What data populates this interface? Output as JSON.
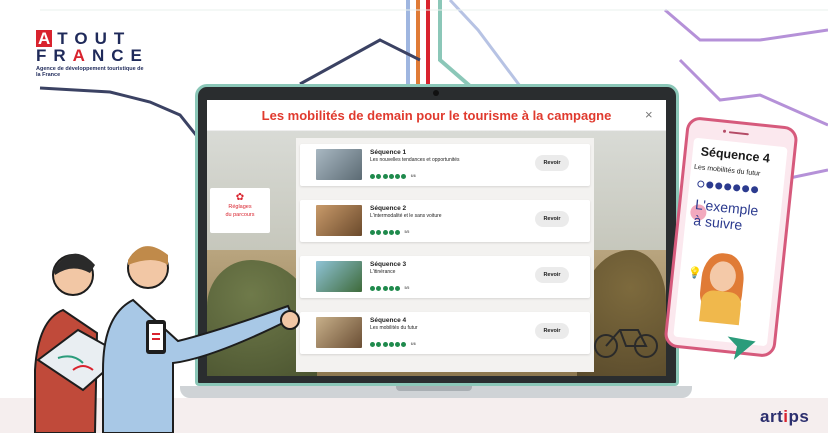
{
  "logo": {
    "line1_first": "A",
    "line1_rest": "TOUT",
    "line2_a": "FR",
    "line2_b": "A",
    "line2_c": "NCE",
    "tagline": "Agence de développement touristique de la France"
  },
  "modal": {
    "title": "Les mobilités de demain pour le tourisme à la campagne",
    "close": "×"
  },
  "settings": {
    "icon": "gear-icon",
    "label_line1": "Réglages",
    "label_line2": "du parcours"
  },
  "sequences": [
    {
      "title": "Séquence 1",
      "subtitle": "Les nouvelles tendances et opportunités",
      "dots": 6,
      "count": "6/6",
      "button": "Revoir",
      "thumb_color": "#7d8f9a"
    },
    {
      "title": "Séquence 2",
      "subtitle": "L'intermodalité et le sans voiture",
      "dots": 5,
      "count": "5/5",
      "button": "Revoir",
      "thumb_color": "#a26b3f"
    },
    {
      "title": "Séquence 3",
      "subtitle": "L'itinérance",
      "dots": 5,
      "count": "5/5",
      "button": "Revoir",
      "thumb_color": "#4f8aa8"
    },
    {
      "title": "Séquence 4",
      "subtitle": "Les mobilités du futur",
      "dots": 6,
      "count": "6/6",
      "button": "Revoir",
      "thumb_color": "#9a7a55"
    }
  ],
  "phone": {
    "title": "Séquence 4",
    "subtitle": "Les mobilités du futur",
    "big_line1": "L'exemple",
    "big_line2": "à suivre"
  },
  "brand": {
    "artips_a": "art",
    "artips_i": "i",
    "artips_b": "ps"
  },
  "colors": {
    "accent_red": "#e03a2e",
    "progress_green": "#1f8a4c",
    "phone_navy": "#2c3b8f"
  }
}
